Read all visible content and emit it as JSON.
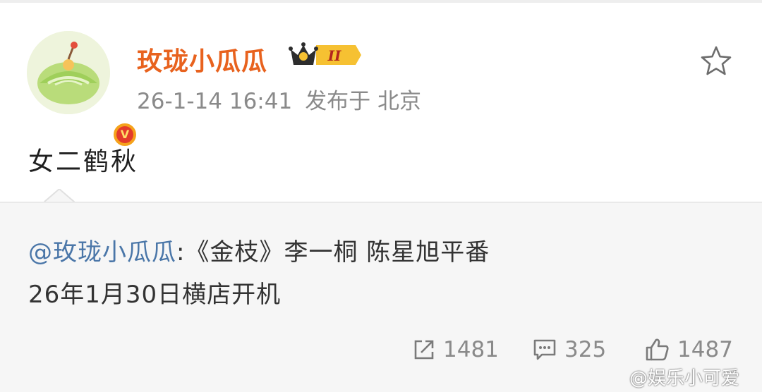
{
  "author": {
    "name": "玫珑小瓜瓜",
    "verified_mark": "V",
    "badge_level": "II"
  },
  "post": {
    "time": "26-1-14 16:41",
    "location": "发布于 北京",
    "text": "女二鹤秋"
  },
  "repost": {
    "mention": "@玫珑小瓜瓜",
    "line1_rest": ":《金枝》李一桐 陈星旭平番",
    "line2": "26年1月30日横店开机"
  },
  "actions": {
    "share_count": "1481",
    "comment_count": "325",
    "like_count": "1487"
  },
  "watermark": "@娱乐小可爱",
  "colors": {
    "username": "#e8621e",
    "mention": "#4a76a8",
    "meta": "#8a8a8a",
    "repost_bg": "#f6f6f6"
  },
  "icons": [
    "star-icon",
    "share-icon",
    "comment-icon",
    "like-icon",
    "crown-badge-icon",
    "verified-icon"
  ]
}
